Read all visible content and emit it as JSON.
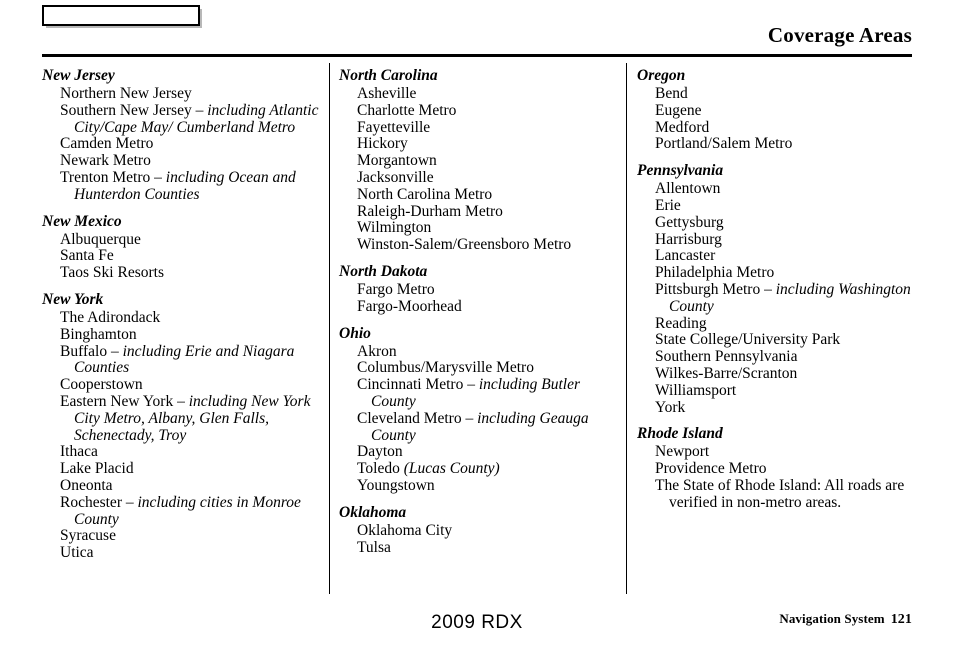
{
  "header": {
    "title": "Coverage Areas",
    "tab_label": ""
  },
  "footer": {
    "model": "2009  RDX",
    "section": "Navigation System",
    "page_number": "121"
  },
  "columns": [
    {
      "states": [
        {
          "name": "New Jersey",
          "entries": [
            {
              "text": "Northern New Jersey"
            },
            {
              "text": "Southern New Jersey – ",
              "italic": "including Atlantic City/Cape May/ Cumberland Metro"
            },
            {
              "text": "Camden Metro"
            },
            {
              "text": "Newark Metro"
            },
            {
              "text": "Trenton Metro – ",
              "italic": "including Ocean and Hunterdon Counties"
            }
          ]
        },
        {
          "name": "New Mexico",
          "entries": [
            {
              "text": "Albuquerque"
            },
            {
              "text": "Santa Fe"
            },
            {
              "text": "Taos Ski Resorts"
            }
          ]
        },
        {
          "name": "New York",
          "entries": [
            {
              "text": "The Adirondack"
            },
            {
              "text": "Binghamton"
            },
            {
              "text": "Buffalo – ",
              "italic": "including Erie and Niagara Counties"
            },
            {
              "text": "Cooperstown"
            },
            {
              "text": "Eastern New York – ",
              "italic": "including New York City Metro, Albany, Glen Falls, Schenectady, Troy"
            },
            {
              "text": "Ithaca"
            },
            {
              "text": "Lake Placid"
            },
            {
              "text": "Oneonta"
            },
            {
              "text": "Rochester – ",
              "italic": "including cities in Monroe County"
            },
            {
              "text": "Syracuse"
            },
            {
              "text": "Utica"
            }
          ]
        }
      ]
    },
    {
      "states": [
        {
          "name": "North Carolina",
          "entries": [
            {
              "text": "Asheville"
            },
            {
              "text": "Charlotte Metro"
            },
            {
              "text": "Fayetteville"
            },
            {
              "text": "Hickory"
            },
            {
              "text": "Morgantown"
            },
            {
              "text": "Jacksonville"
            },
            {
              "text": "North Carolina Metro"
            },
            {
              "text": "Raleigh-Durham Metro"
            },
            {
              "text": "Wilmington"
            },
            {
              "text": "Winston-Salem/Greensboro Metro"
            }
          ]
        },
        {
          "name": "North Dakota",
          "entries": [
            {
              "text": "Fargo Metro"
            },
            {
              "text": "Fargo-Moorhead"
            }
          ]
        },
        {
          "name": "Ohio",
          "entries": [
            {
              "text": "Akron"
            },
            {
              "text": "Columbus/Marysville Metro"
            },
            {
              "text": "Cincinnati Metro – ",
              "italic": "including Butler County"
            },
            {
              "text": "Cleveland Metro – ",
              "italic": "including Geauga County"
            },
            {
              "text": "Dayton"
            },
            {
              "text": "Toledo ",
              "italic": "(Lucas County)"
            },
            {
              "text": "Youngstown"
            }
          ]
        },
        {
          "name": "Oklahoma",
          "entries": [
            {
              "text": "Oklahoma City"
            },
            {
              "text": "Tulsa"
            }
          ]
        }
      ]
    },
    {
      "states": [
        {
          "name": "Oregon",
          "entries": [
            {
              "text": "Bend"
            },
            {
              "text": "Eugene"
            },
            {
              "text": "Medford"
            },
            {
              "text": "Portland/Salem Metro"
            }
          ]
        },
        {
          "name": "Pennsylvania",
          "entries": [
            {
              "text": "Allentown"
            },
            {
              "text": "Erie"
            },
            {
              "text": "Gettysburg"
            },
            {
              "text": "Harrisburg"
            },
            {
              "text": "Lancaster"
            },
            {
              "text": "Philadelphia Metro"
            },
            {
              "text": "Pittsburgh Metro – ",
              "italic": "including Washington County"
            },
            {
              "text": "Reading"
            },
            {
              "text": "State College/University Park"
            },
            {
              "text": "Southern Pennsylvania"
            },
            {
              "text": "Wilkes-Barre/Scranton"
            },
            {
              "text": "Williamsport"
            },
            {
              "text": "York"
            }
          ]
        },
        {
          "name": "Rhode Island",
          "entries": [
            {
              "text": "Newport"
            },
            {
              "text": "Providence Metro"
            },
            {
              "text": "The State of Rhode Island: All roads are verified in non-metro areas."
            }
          ]
        }
      ]
    }
  ]
}
